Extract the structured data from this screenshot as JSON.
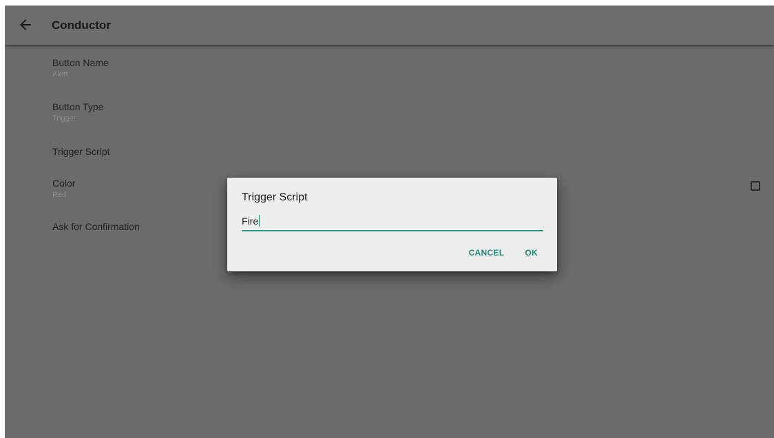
{
  "appbar": {
    "title": "Conductor",
    "back_icon": "arrow-left-icon"
  },
  "preferences": [
    {
      "title": "Button Name",
      "summary": "Alert"
    },
    {
      "title": "Button Type",
      "summary": "Trigger"
    },
    {
      "title": "Trigger Script",
      "summary": ""
    },
    {
      "title": "Color",
      "summary": "Red"
    },
    {
      "title": "Ask for Confirmation",
      "summary": "",
      "checked": false
    }
  ],
  "dialog": {
    "title": "Trigger Script",
    "input_value": "Fire",
    "cancel_label": "CANCEL",
    "ok_label": "OK"
  },
  "colors": {
    "accent": "#1f8a78",
    "background_dim": "#6b6b6b",
    "dialog_bg": "#eeeeee"
  }
}
